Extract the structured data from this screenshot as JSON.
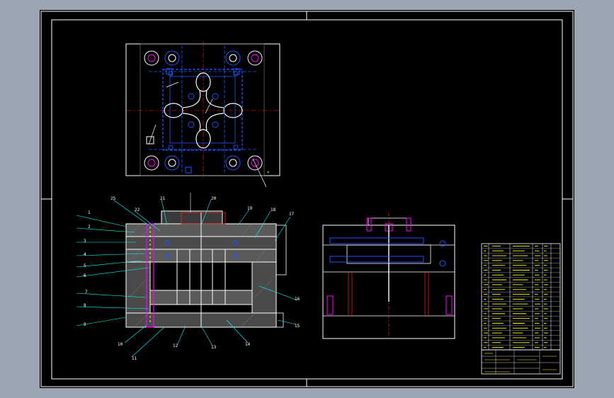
{
  "drawing": {
    "colors": {
      "desktop": "#9ca6b2",
      "paper": "#000000",
      "frame": "#ffffff",
      "outline": "#ffffff",
      "hatch": "#8a8a8a",
      "cooling": "#2255ff",
      "center_line": "#ff2222",
      "leader": "#00ffff",
      "note": "#ffff00",
      "highlight": "#ff00ff"
    },
    "callouts_left": [
      "1",
      "2",
      "3",
      "4",
      "5",
      "6",
      "7",
      "8",
      "9"
    ],
    "callouts_top": [
      "25",
      "22",
      "21",
      "20",
      "19",
      "18",
      "17"
    ],
    "callouts_bottom": [
      "10",
      "11",
      "12",
      "13",
      "14",
      "15",
      "16"
    ],
    "bom_rows": 22
  }
}
